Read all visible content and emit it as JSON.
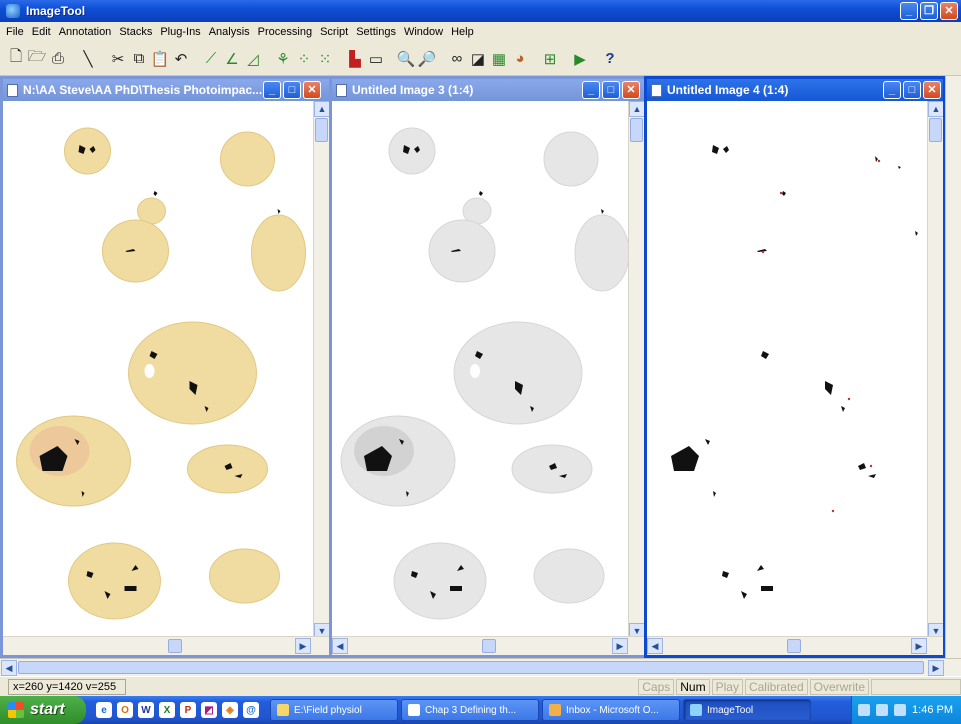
{
  "window": {
    "title": "ImageTool"
  },
  "menu": [
    "File",
    "Edit",
    "Annotation",
    "Stacks",
    "Plug-Ins",
    "Analysis",
    "Processing",
    "Script",
    "Settings",
    "Window",
    "Help"
  ],
  "toolbar": {
    "icons": [
      "new-icon",
      "open-icon",
      "print-icon",
      "line-icon",
      "cut-icon",
      "copy-icon",
      "paste-icon",
      "undo-icon",
      "ruler-icon",
      "angle-icon",
      "area-icon",
      "tree-icon",
      "scatter-icon",
      "plot-icon",
      "histogram-icon",
      "profile-icon",
      "zoom-in-icon",
      "zoom-out-icon",
      "dots-icon",
      "contrast-icon",
      "calculator-icon",
      "palette-icon",
      "grid-icon",
      "run-icon",
      "help-icon"
    ],
    "help_label": "?"
  },
  "children": [
    {
      "title": "N:\\AA Steve\\AA PhD\\Thesis Photoimpac...",
      "active": false
    },
    {
      "title": "Untitled Image 3 (1:4)",
      "active": false
    },
    {
      "title": "Untitled Image 4 (1:4)",
      "active": true
    }
  ],
  "status": {
    "coords": "x=260 y=1420 v=255",
    "indicators": [
      {
        "label": "Caps",
        "on": false
      },
      {
        "label": "Num",
        "on": true
      },
      {
        "label": "Play",
        "on": false
      },
      {
        "label": "Calibrated",
        "on": false
      },
      {
        "label": "Overwrite",
        "on": false
      }
    ]
  },
  "taskbar": {
    "start": "start",
    "tasks": [
      {
        "label": "E:\\Field physiol",
        "active": false
      },
      {
        "label": "Chap 3 Defining th...",
        "active": false
      },
      {
        "label": "Inbox - Microsoft O...",
        "active": false
      },
      {
        "label": "ImageTool",
        "active": true
      }
    ],
    "clock": "1:46 PM"
  },
  "colors": {
    "title_blue": "#0c4bd0",
    "leaf_yellow": "#f0dca0",
    "leaf_grey": "#e3e3e3",
    "lesion": "#111111"
  }
}
